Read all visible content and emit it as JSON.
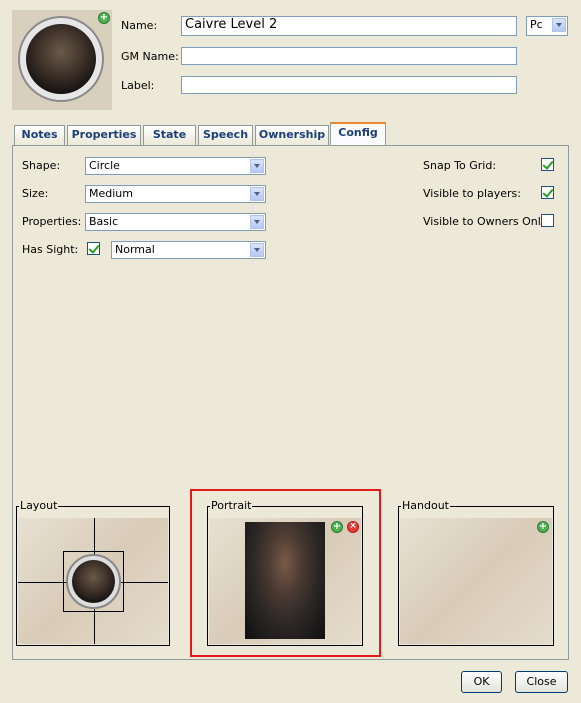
{
  "header": {
    "name_label": "Name:",
    "name_value": "Caivre Level 2",
    "type_select": "Pc",
    "gm_name_label": "GM Name:",
    "gm_name_value": "",
    "label_label": "Label:",
    "label_value": ""
  },
  "tabs": [
    {
      "label": "Notes",
      "active": false
    },
    {
      "label": "Properties",
      "active": false
    },
    {
      "label": "State",
      "active": false
    },
    {
      "label": "Speech",
      "active": false
    },
    {
      "label": "Ownership",
      "active": false
    },
    {
      "label": "Config",
      "active": true
    }
  ],
  "config": {
    "shape_label": "Shape:",
    "shape_value": "Circle",
    "size_label": "Size:",
    "size_value": "Medium",
    "properties_label": "Properties:",
    "properties_value": "Basic",
    "sight_label": "Has Sight:",
    "sight_checked": true,
    "sight_value": "Normal",
    "snap_label": "Snap To Grid:",
    "snap_checked": true,
    "visible_label": "Visible to players:",
    "visible_checked": true,
    "owners_label": "Visible to Owners Only",
    "owners_checked": false
  },
  "images": {
    "layout_label": "Layout",
    "portrait_label": "Portrait",
    "handout_label": "Handout"
  },
  "buttons": {
    "ok": "OK",
    "close": "Close"
  },
  "icons": {
    "add": "add-icon",
    "remove": "remove-icon",
    "dropdown": "chevron-down-icon"
  }
}
